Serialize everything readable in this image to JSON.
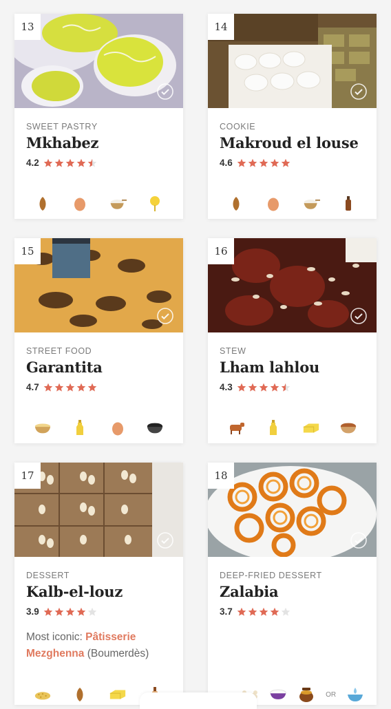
{
  "colors": {
    "accent": "#e06a55",
    "star_empty": "#e3e3e3"
  },
  "cards": [
    {
      "num": "13",
      "category": "SWEET PASTRY",
      "name": "Mkhabez",
      "rating": "4.2",
      "stars": [
        1,
        1,
        1,
        1,
        0.5
      ],
      "ingredients": [
        "almond-icon",
        "egg-icon",
        "flour-bowl-icon",
        "lemon-squeezer-icon"
      ]
    },
    {
      "num": "14",
      "category": "COOKIE",
      "name": "Makroud el louse",
      "rating": "4.6",
      "stars": [
        1,
        1,
        1,
        1,
        1
      ],
      "ingredients": [
        "almond-icon",
        "egg-icon",
        "flour-bowl-icon",
        "vanilla-bottle-icon"
      ]
    },
    {
      "num": "15",
      "category": "STREET FOOD",
      "name": "Garantita",
      "rating": "4.7",
      "stars": [
        1,
        1,
        1,
        1,
        1
      ],
      "ingredients": [
        "chickpea-flour-bowl-icon",
        "oil-bottle-icon",
        "egg-icon",
        "black-seeds-bowl-icon"
      ]
    },
    {
      "num": "16",
      "category": "STEW",
      "name": "Lham lahlou",
      "rating": "4.3",
      "stars": [
        1,
        1,
        1,
        1,
        0.5
      ],
      "ingredients": [
        "lamb-icon",
        "oil-bottle-icon",
        "butter-icon",
        "spice-bowl-icon"
      ]
    },
    {
      "num": "17",
      "category": "DESSERT",
      "name": "Kalb-el-louz",
      "rating": "3.9",
      "stars": [
        1,
        1,
        1,
        1,
        0
      ],
      "note": {
        "prefix": "Most iconic: ",
        "place": "Pâtisserie Mezghenna",
        "suffix": " (Boumerdès)"
      },
      "ingredients": [
        "semolina-icon",
        "almond-icon",
        "butter-icon",
        "orange-blossom-bottle-icon"
      ]
    },
    {
      "num": "18",
      "category": "DEEP-FRIED DESSERT",
      "name": "Zalabia",
      "rating": "3.7",
      "stars": [
        1,
        1,
        1,
        1,
        0
      ],
      "ingredients": [
        "bone-icon",
        "yogurt-bowl-icon",
        "honey-pot-icon"
      ],
      "or_label": "OR",
      "alt_ingredient": "water-bowl-icon"
    }
  ]
}
